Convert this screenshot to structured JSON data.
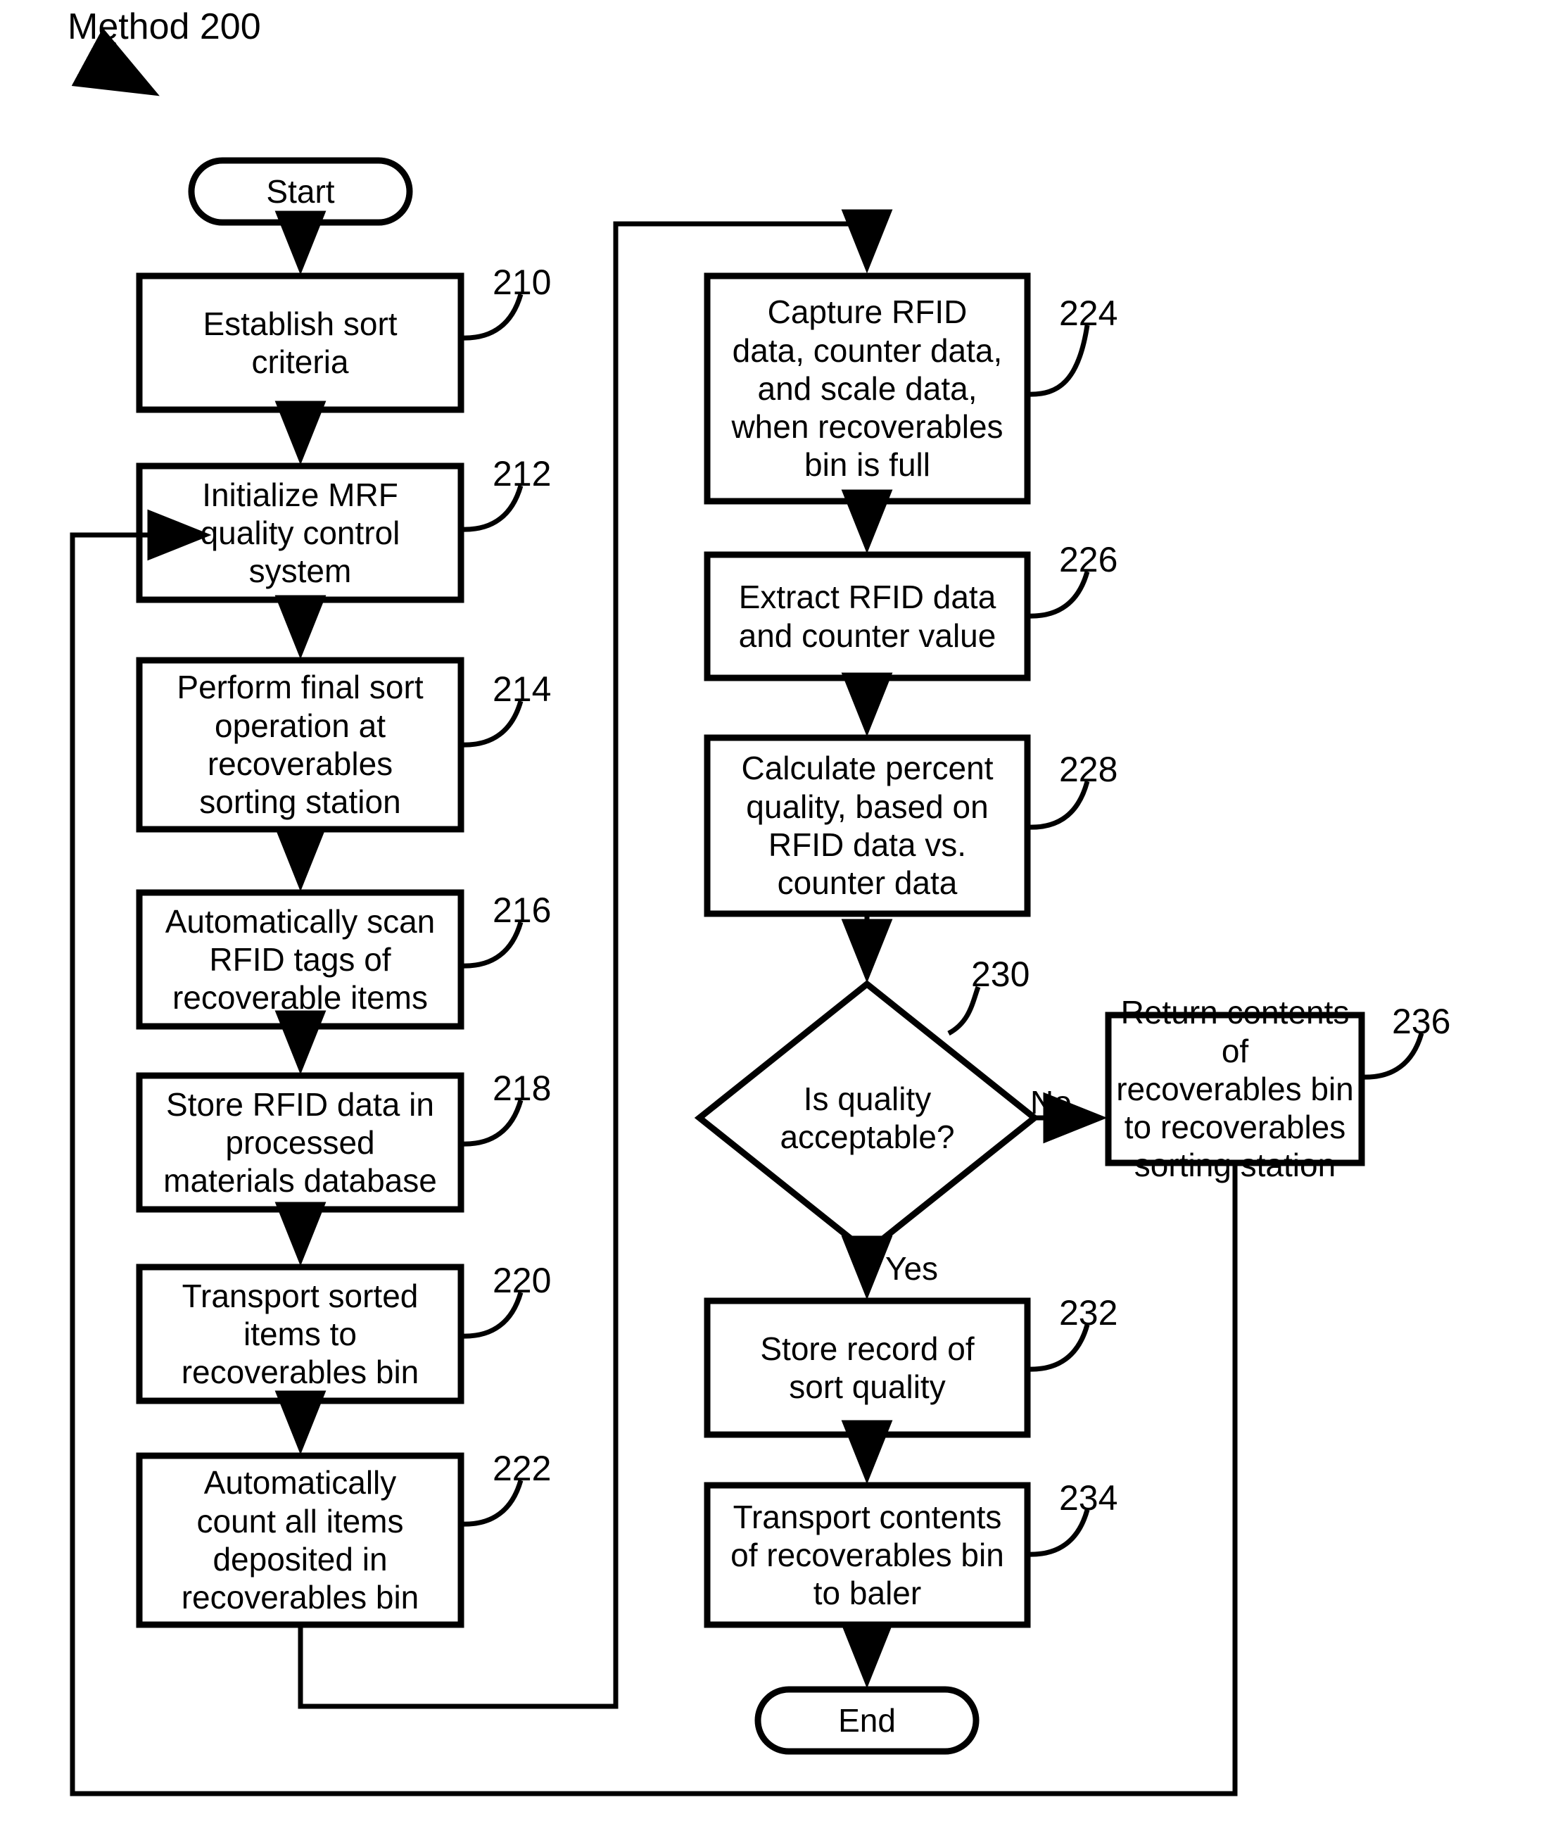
{
  "figure": {
    "caption": "Method 200"
  },
  "diagram_type": "flowchart",
  "terminals": {
    "start": "Start",
    "end": "End"
  },
  "edge_labels": {
    "no": "No",
    "yes": "Yes"
  },
  "nodes": [
    {
      "id": "start",
      "shape": "terminator",
      "label": "Start",
      "ref": ""
    },
    {
      "id": "n210",
      "shape": "process",
      "label": "Establish sort\ncriteria",
      "ref": "210"
    },
    {
      "id": "n212",
      "shape": "process",
      "label": "Initialize MRF\nquality control\nsystem",
      "ref": "212"
    },
    {
      "id": "n214",
      "shape": "process",
      "label": "Perform final sort\noperation at\nrecoverables\nsorting station",
      "ref": "214"
    },
    {
      "id": "n216",
      "shape": "process",
      "label": "Automatically scan\nRFID tags of\nrecoverable items",
      "ref": "216"
    },
    {
      "id": "n218",
      "shape": "process",
      "label": "Store RFID data in\nprocessed\nmaterials database",
      "ref": "218"
    },
    {
      "id": "n220",
      "shape": "process",
      "label": "Transport sorted\nitems to\nrecoverables bin",
      "ref": "220"
    },
    {
      "id": "n222",
      "shape": "process",
      "label": "Automatically\ncount all items\ndeposited in\nrecoverables bin",
      "ref": "222"
    },
    {
      "id": "n224",
      "shape": "process",
      "label": "Capture RFID\ndata, counter data,\nand scale data,\nwhen recoverables\nbin is full",
      "ref": "224"
    },
    {
      "id": "n226",
      "shape": "process",
      "label": "Extract RFID data\nand counter value",
      "ref": "226"
    },
    {
      "id": "n228",
      "shape": "process",
      "label": "Calculate percent\nquality, based on\nRFID data vs.\ncounter data",
      "ref": "228"
    },
    {
      "id": "n230",
      "shape": "decision",
      "label": "Is quality\nacceptable?",
      "ref": "230"
    },
    {
      "id": "n232",
      "shape": "process",
      "label": "Store record of\nsort quality",
      "ref": "232"
    },
    {
      "id": "n234",
      "shape": "process",
      "label": "Transport contents\nof recoverables bin\nto baler",
      "ref": "234"
    },
    {
      "id": "n236",
      "shape": "process",
      "label": "Return contents of\nrecoverables bin\nto recoverables\nsorting station",
      "ref": "236"
    },
    {
      "id": "end",
      "shape": "terminator",
      "label": "End",
      "ref": ""
    }
  ],
  "edges": [
    {
      "from": "start",
      "to": "n210",
      "label": ""
    },
    {
      "from": "n210",
      "to": "n212",
      "label": ""
    },
    {
      "from": "n212",
      "to": "n214",
      "label": ""
    },
    {
      "from": "n214",
      "to": "n216",
      "label": ""
    },
    {
      "from": "n216",
      "to": "n218",
      "label": ""
    },
    {
      "from": "n218",
      "to": "n220",
      "label": ""
    },
    {
      "from": "n220",
      "to": "n222",
      "label": ""
    },
    {
      "from": "n222",
      "to": "n224",
      "label": ""
    },
    {
      "from": "n224",
      "to": "n226",
      "label": ""
    },
    {
      "from": "n226",
      "to": "n228",
      "label": ""
    },
    {
      "from": "n228",
      "to": "n230",
      "label": ""
    },
    {
      "from": "n230",
      "to": "n236",
      "label": "No"
    },
    {
      "from": "n230",
      "to": "n232",
      "label": "Yes"
    },
    {
      "from": "n232",
      "to": "n234",
      "label": ""
    },
    {
      "from": "n234",
      "to": "end",
      "label": ""
    },
    {
      "from": "n236",
      "to": "n212",
      "label": ""
    }
  ],
  "style": {
    "stroke": "#000000",
    "fill": "#ffffff",
    "background": "#ffffff"
  }
}
